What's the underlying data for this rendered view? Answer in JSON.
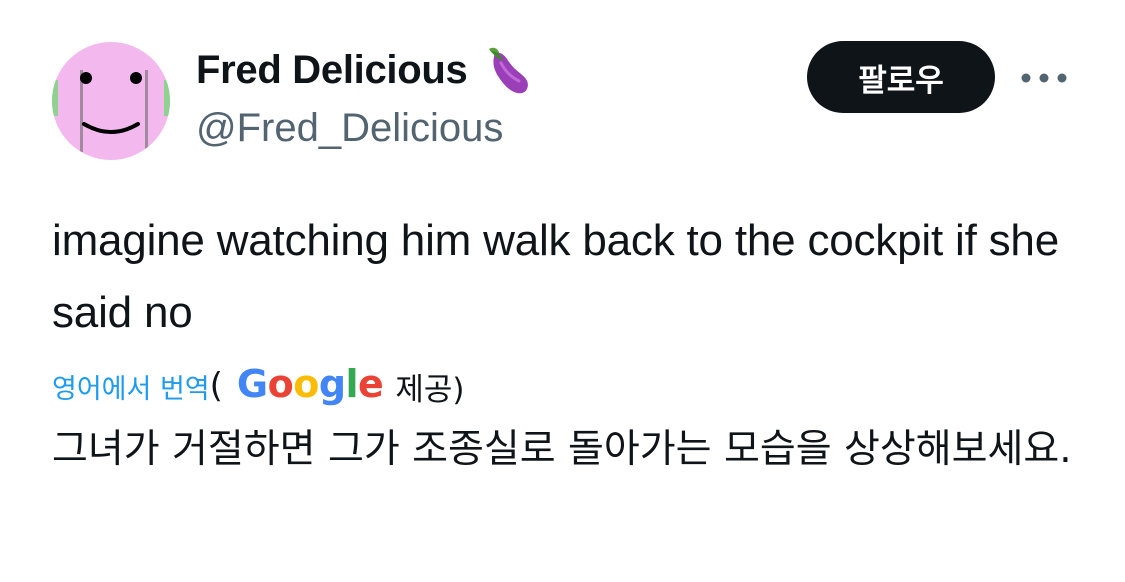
{
  "author": {
    "display_name": "Fred Delicious",
    "name_emoji": "eggplant-icon",
    "handle": "@Fred_Delicious",
    "avatar": "pink-smiley-face-avatar"
  },
  "actions": {
    "follow_label": "팔로우",
    "more_icon": "more-horizontal-icon"
  },
  "tweet": {
    "text": "imagine watching him walk back to the cockpit if she said no"
  },
  "translation": {
    "link_label": "영어에서 번역",
    "paren_open": "(",
    "provider": "Google",
    "provided_label": "제공)",
    "text": "그녀가 거절하면 그가 조종실로 돌아가는 모습을 상상해보세요."
  },
  "colors": {
    "accent": "#1d9bf0",
    "text": "#0f1419",
    "secondary": "#536471",
    "follow_bg": "#0f1419",
    "avatar_pink": "#f3b9ef",
    "google_blue": "#4285F4",
    "google_red": "#EA4335",
    "google_yellow": "#FBBC05",
    "google_green": "#34A853"
  }
}
